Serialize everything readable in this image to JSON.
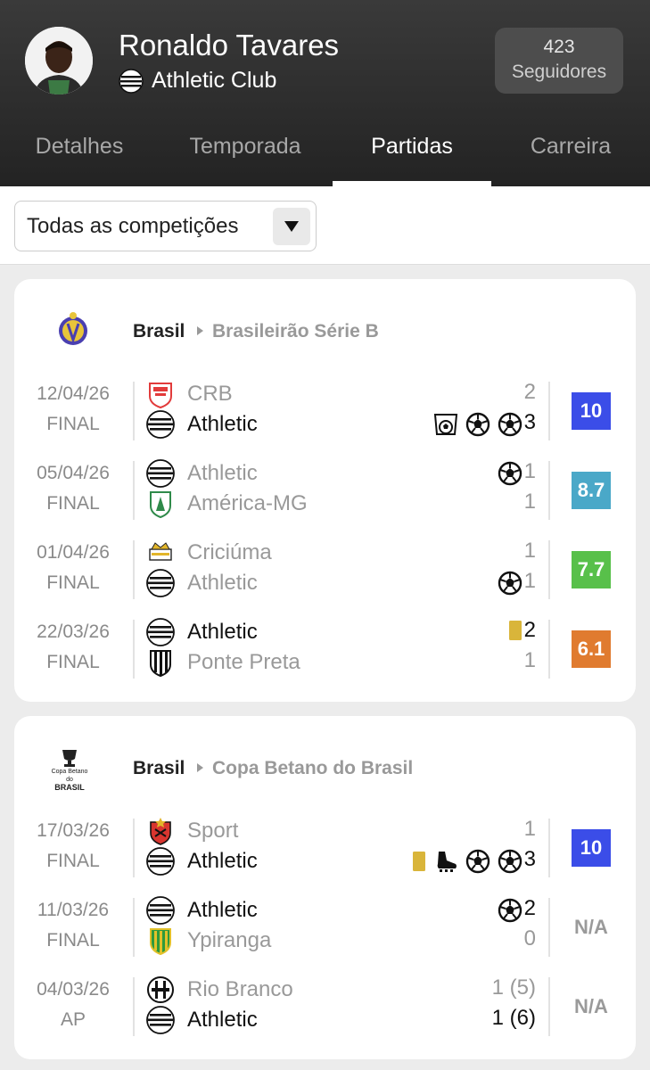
{
  "player": {
    "name": "Ronaldo Tavares",
    "club": "Athletic Club",
    "followers_count": "423",
    "followers_label": "Seguidores"
  },
  "tabs": [
    {
      "label": "Detalhes",
      "active": false
    },
    {
      "label": "Temporada",
      "active": false
    },
    {
      "label": "Partidas",
      "active": true
    },
    {
      "label": "Carreira",
      "active": false
    }
  ],
  "filter": {
    "selected": "Todas as competições"
  },
  "competitions": [
    {
      "country": "Brasil",
      "name": "Brasileirão Série B",
      "logo": "brasileirao-serie-b-logo",
      "matches": [
        {
          "date": "12/04/26",
          "status": "FINAL",
          "home": {
            "name": "CRB",
            "logo": "crb-logo",
            "score": "2",
            "bold": false
          },
          "away": {
            "name": "Athletic",
            "logo": "athletic-logo",
            "score": "3",
            "bold": true
          },
          "home_events": [],
          "away_events": [
            "goal-in-net-icon",
            "goal-icon",
            "goal-icon"
          ],
          "rating": "10",
          "rating_color": "#3b4de8"
        },
        {
          "date": "05/04/26",
          "status": "FINAL",
          "home": {
            "name": "Athletic",
            "logo": "athletic-logo",
            "score": "1",
            "bold": false
          },
          "away": {
            "name": "América-MG",
            "logo": "america-mg-logo",
            "score": "1",
            "bold": false
          },
          "home_events": [
            "goal-icon"
          ],
          "away_events": [],
          "rating": "8.7",
          "rating_color": "#4aa8c8"
        },
        {
          "date": "01/04/26",
          "status": "FINAL",
          "home": {
            "name": "Criciúma",
            "logo": "criciuma-logo",
            "score": "1",
            "bold": false
          },
          "away": {
            "name": "Athletic",
            "logo": "athletic-logo",
            "score": "1",
            "bold": false
          },
          "home_events": [],
          "away_events": [
            "goal-icon"
          ],
          "rating": "7.7",
          "rating_color": "#58c04a"
        },
        {
          "date": "22/03/26",
          "status": "FINAL",
          "home": {
            "name": "Athletic",
            "logo": "athletic-logo",
            "score": "2",
            "bold": true
          },
          "away": {
            "name": "Ponte Preta",
            "logo": "ponte-preta-logo",
            "score": "1",
            "bold": false
          },
          "home_events": [
            "yellow-card-icon"
          ],
          "away_events": [],
          "rating": "6.1",
          "rating_color": "#e07b2f"
        }
      ]
    },
    {
      "country": "Brasil",
      "name": "Copa Betano do Brasil",
      "logo": "copa-do-brasil-logo",
      "logo_text": [
        "Copa Betano",
        "do",
        "BRASIL"
      ],
      "matches": [
        {
          "date": "17/03/26",
          "status": "FINAL",
          "home": {
            "name": "Sport",
            "logo": "sport-logo",
            "score": "1",
            "bold": false
          },
          "away": {
            "name": "Athletic",
            "logo": "athletic-logo",
            "score": "3",
            "bold": true
          },
          "home_events": [],
          "away_events": [
            "yellow-card-icon",
            "boot-icon",
            "goal-icon",
            "goal-icon"
          ],
          "rating": "10",
          "rating_color": "#3b4de8"
        },
        {
          "date": "11/03/26",
          "status": "FINAL",
          "home": {
            "name": "Athletic",
            "logo": "athletic-logo",
            "score": "2",
            "bold": true
          },
          "away": {
            "name": "Ypiranga",
            "logo": "ypiranga-logo",
            "score": "0",
            "bold": false
          },
          "home_events": [
            "goal-icon"
          ],
          "away_events": [],
          "rating": "N/A",
          "rating_color": ""
        },
        {
          "date": "04/03/26",
          "status": "AP",
          "home": {
            "name": "Rio Branco",
            "logo": "rio-branco-logo",
            "score": "1 (5)",
            "bold": false
          },
          "away": {
            "name": "Athletic",
            "logo": "athletic-logo",
            "score": "1 (6)",
            "bold": true
          },
          "home_events": [],
          "away_events": [],
          "rating": "N/A",
          "rating_color": ""
        }
      ]
    }
  ]
}
